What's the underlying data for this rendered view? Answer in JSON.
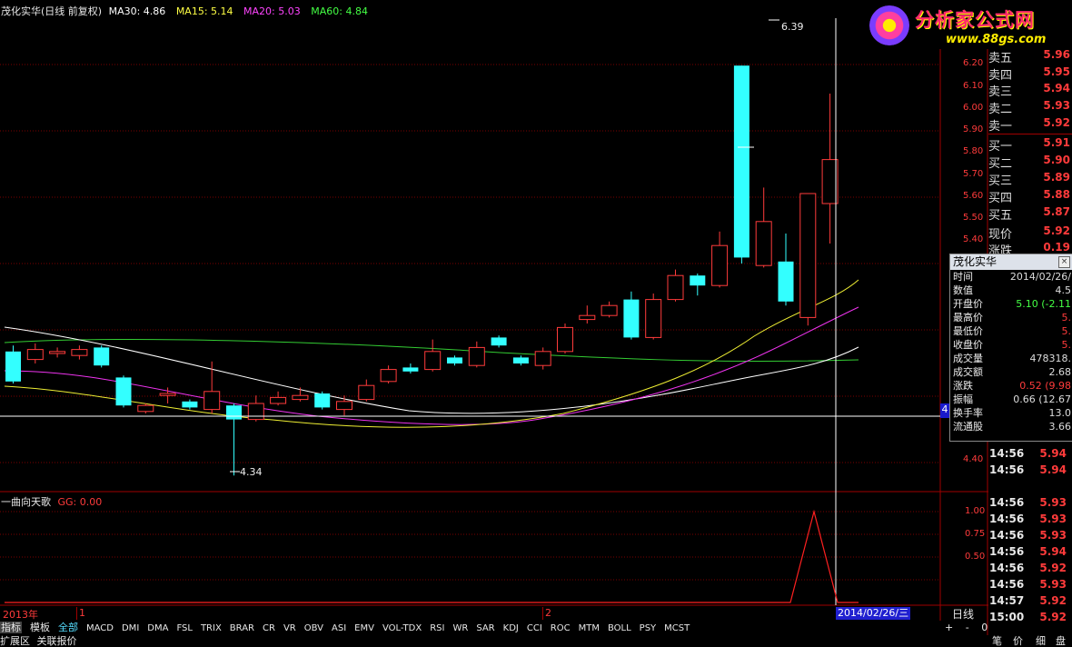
{
  "header": {
    "stock_title": "茂化实华(日线 前复权)",
    "ma_items": [
      {
        "label": "MA30: 4.86",
        "color": "#ffffff"
      },
      {
        "label": "MA15: 5.14",
        "color": "#ffff44"
      },
      {
        "label": "MA20: 5.03",
        "color": "#ff44ff"
      },
      {
        "label": "MA60: 4.84",
        "color": "#44ff44"
      }
    ]
  },
  "logo": {
    "text": "分析家公式网",
    "url": "www.88gs.com"
  },
  "price_axis": [
    "6.20",
    "6.10",
    "6.00",
    "5.90",
    "5.80",
    "5.70",
    "5.60",
    "5.50",
    "5.40",
    "4.40"
  ],
  "annotations": {
    "high": "6.39",
    "low": "4.34",
    "crosshair_value": "4"
  },
  "order_book": [
    {
      "label": "卖五",
      "value": "5.96"
    },
    {
      "label": "卖四",
      "value": "5.95"
    },
    {
      "label": "卖三",
      "value": "5.94"
    },
    {
      "label": "卖二",
      "value": "5.93"
    },
    {
      "label": "卖一",
      "value": "5.92"
    },
    {
      "label": "买一",
      "value": "5.91"
    },
    {
      "label": "买二",
      "value": "5.90"
    },
    {
      "label": "买三",
      "value": "5.89"
    },
    {
      "label": "买四",
      "value": "5.88"
    },
    {
      "label": "买五",
      "value": "5.87"
    },
    {
      "label": "现价",
      "value": "5.92"
    },
    {
      "label": "涨跌",
      "value": "0.19"
    }
  ],
  "popup": {
    "title": "茂化实华",
    "rows": [
      {
        "label": "时间",
        "value": "2014/02/26/",
        "color": "#dddddd"
      },
      {
        "label": "数值",
        "value": "4.5",
        "color": "#dddddd"
      },
      {
        "label": "开盘价",
        "value": "5.10 (-2.11",
        "color": "#44ff44"
      },
      {
        "label": "最高价",
        "value": "5.",
        "color": "#ff3b3b"
      },
      {
        "label": "最低价",
        "value": "5.",
        "color": "#ff3b3b"
      },
      {
        "label": "收盘价",
        "value": "5.",
        "color": "#ff3b3b"
      },
      {
        "label": "成交量",
        "value": "478318.",
        "color": "#dddddd"
      },
      {
        "label": "成交额",
        "value": "2.68",
        "color": "#dddddd"
      },
      {
        "label": "涨跌",
        "value": "0.52 (9.98",
        "color": "#ff3b3b"
      },
      {
        "label": "振幅",
        "value": "0.66 (12.67",
        "color": "#dddddd"
      },
      {
        "label": "换手率",
        "value": "13.0",
        "color": "#dddddd"
      },
      {
        "label": "流通股",
        "value": "3.66",
        "color": "#dddddd"
      }
    ]
  },
  "ticks": [
    {
      "time": "14:56",
      "price": "5.94"
    },
    {
      "time": "14:56",
      "price": "5.94"
    },
    {
      "time": "14:56",
      "price": "5.93"
    },
    {
      "time": "14:56",
      "price": "5.93"
    },
    {
      "time": "14:56",
      "price": "5.93"
    },
    {
      "time": "14:56",
      "price": "5.94"
    },
    {
      "time": "14:56",
      "price": "5.92"
    },
    {
      "time": "14:56",
      "price": "5.93"
    },
    {
      "time": "14:57",
      "price": "5.92"
    },
    {
      "time": "15:00",
      "price": "5.92"
    }
  ],
  "indicator": {
    "name": "一曲向天歌",
    "value_label": "GG: 0.00",
    "axis": [
      "1.00",
      "0.75",
      "0.50"
    ]
  },
  "time_axis": {
    "year_label": "2013年",
    "m1": "1",
    "m2": "2",
    "date": "2014/02/26/三",
    "period": "日线"
  },
  "tabs": [
    "指标",
    "模板",
    "全部",
    "MACD",
    "DMI",
    "DMA",
    "FSL",
    "TRIX",
    "BRAR",
    "CR",
    "VR",
    "OBV",
    "ASI",
    "EMV",
    "VOL-TDX",
    "RSI",
    "WR",
    "SAR",
    "KDJ",
    "CCI",
    "ROC",
    "MTM",
    "BOLL",
    "PSY",
    "MCST"
  ],
  "bottom_bar": {
    "left1": "扩展区",
    "left2": "关联报价",
    "nav": [
      "+",
      "-",
      "0"
    ],
    "right": [
      "笔",
      "价",
      "细",
      "盘"
    ]
  },
  "chart_data": {
    "type": "candlestick",
    "candles": [
      {
        "o": 4.96,
        "c": 4.81,
        "h": 4.99,
        "l": 4.8
      },
      {
        "o": 4.92,
        "c": 4.97,
        "h": 5.0,
        "l": 4.9
      },
      {
        "o": 4.95,
        "c": 4.96,
        "h": 4.98,
        "l": 4.93
      },
      {
        "o": 4.94,
        "c": 4.97,
        "h": 4.99,
        "l": 4.92
      },
      {
        "o": 4.98,
        "c": 4.89,
        "h": 4.99,
        "l": 4.88
      },
      {
        "o": 4.83,
        "c": 4.69,
        "h": 4.84,
        "l": 4.68
      },
      {
        "o": 4.66,
        "c": 4.69,
        "h": 4.7,
        "l": 4.65
      },
      {
        "o": 4.74,
        "c": 4.75,
        "h": 4.78,
        "l": 4.7
      },
      {
        "o": 4.71,
        "c": 4.68,
        "h": 4.72,
        "l": 4.67
      },
      {
        "o": 4.67,
        "c": 4.76,
        "h": 4.91,
        "l": 4.65
      },
      {
        "o": 4.69,
        "c": 4.62,
        "h": 4.7,
        "l": 4.34
      },
      {
        "o": 4.62,
        "c": 4.7,
        "h": 4.74,
        "l": 4.61
      },
      {
        "o": 4.7,
        "c": 4.73,
        "h": 4.76,
        "l": 4.69
      },
      {
        "o": 4.72,
        "c": 4.74,
        "h": 4.78,
        "l": 4.71
      },
      {
        "o": 4.75,
        "c": 4.68,
        "h": 4.76,
        "l": 4.67
      },
      {
        "o": 4.67,
        "c": 4.71,
        "h": 4.74,
        "l": 4.64
      },
      {
        "o": 4.72,
        "c": 4.79,
        "h": 4.82,
        "l": 4.71
      },
      {
        "o": 4.81,
        "c": 4.87,
        "h": 4.89,
        "l": 4.8
      },
      {
        "o": 4.88,
        "c": 4.86,
        "h": 4.9,
        "l": 4.85
      },
      {
        "o": 4.87,
        "c": 4.96,
        "h": 5.02,
        "l": 4.86
      },
      {
        "o": 4.93,
        "c": 4.9,
        "h": 4.94,
        "l": 4.89
      },
      {
        "o": 4.89,
        "c": 4.98,
        "h": 5.01,
        "l": 4.88
      },
      {
        "o": 5.03,
        "c": 4.99,
        "h": 5.04,
        "l": 4.98
      },
      {
        "o": 4.93,
        "c": 4.9,
        "h": 4.94,
        "l": 4.89
      },
      {
        "o": 4.89,
        "c": 4.96,
        "h": 4.98,
        "l": 4.87
      },
      {
        "o": 4.96,
        "c": 5.08,
        "h": 5.1,
        "l": 4.95
      },
      {
        "o": 5.12,
        "c": 5.14,
        "h": 5.19,
        "l": 5.1
      },
      {
        "o": 5.14,
        "c": 5.19,
        "h": 5.21,
        "l": 5.13
      },
      {
        "o": 5.22,
        "c": 5.03,
        "h": 5.26,
        "l": 5.02
      },
      {
        "o": 5.03,
        "c": 5.22,
        "h": 5.25,
        "l": 5.02
      },
      {
        "o": 5.22,
        "c": 5.34,
        "h": 5.37,
        "l": 5.21
      },
      {
        "o": 5.34,
        "c": 5.29,
        "h": 5.35,
        "l": 5.24
      },
      {
        "o": 5.29,
        "c": 5.49,
        "h": 5.56,
        "l": 5.28
      },
      {
        "o": 6.39,
        "c": 5.43,
        "h": 6.39,
        "l": 5.4
      },
      {
        "o": 5.39,
        "c": 5.61,
        "h": 5.78,
        "l": 5.38
      },
      {
        "o": 5.41,
        "c": 5.21,
        "h": 5.55,
        "l": 5.19
      },
      {
        "o": 5.13,
        "c": 5.75,
        "h": 5.75,
        "l": 5.09
      },
      {
        "o": 5.7,
        "c": 5.92,
        "h": 6.25,
        "l": 5.5
      }
    ]
  }
}
